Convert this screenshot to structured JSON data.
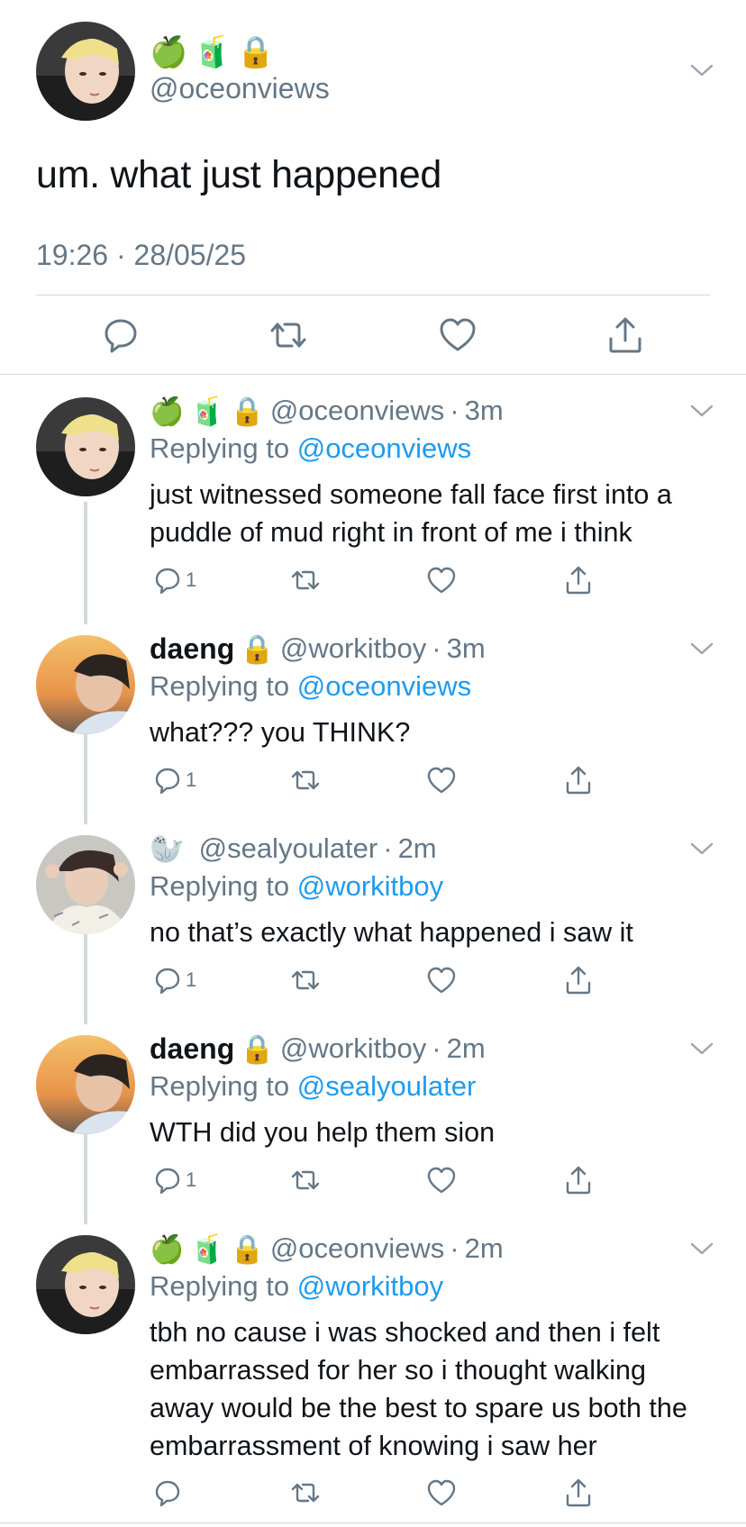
{
  "main": {
    "emojis": [
      "🍏",
      "🧃",
      "🔒"
    ],
    "handle": "@oceonviews",
    "text": "um. what just happened",
    "timestamp": "19:26 · 28/05/25"
  },
  "replies": [
    {
      "name": "",
      "emojis": [
        "🍏",
        "🧃",
        "🔒"
      ],
      "handle": "@oceonviews",
      "time": "3m",
      "replying_prefix": "Replying to",
      "replying_to": "@oceonviews",
      "body": "just witnessed someone fall face first into a puddle of mud right in front of me i think",
      "reply_count": "1"
    },
    {
      "name": "daeng",
      "emojis": [
        "🔒"
      ],
      "handle": "@workitboy",
      "time": "3m",
      "replying_prefix": "Replying to",
      "replying_to": "@oceonviews",
      "body": "what??? you THINK?",
      "reply_count": "1"
    },
    {
      "name": "",
      "emojis": [
        "🦭"
      ],
      "handle": "@sealyoulater",
      "time": "2m",
      "replying_prefix": "Replying to",
      "replying_to": "@workitboy",
      "body": "no that’s exactly what happened i saw it",
      "reply_count": "1"
    },
    {
      "name": "daeng",
      "emojis": [
        "🔒"
      ],
      "handle": "@workitboy",
      "time": "2m",
      "replying_prefix": "Replying to",
      "replying_to": "@sealyoulater",
      "body": "WTH did you help them sion",
      "reply_count": "1"
    },
    {
      "name": "",
      "emojis": [
        "🍏",
        "🧃",
        "🔒"
      ],
      "handle": "@oceonviews",
      "time": "2m",
      "replying_prefix": "Replying to",
      "replying_to": "@workitboy",
      "body": "tbh no cause i was shocked and then i felt embarrassed for her so i thought walking away would be the best to spare us both the embarrassment of knowing i saw her",
      "reply_count": ""
    }
  ],
  "icons": {
    "reply": "reply-icon",
    "retweet": "retweet-icon",
    "like": "heart-icon",
    "share": "share-icon",
    "more": "chevron-down-icon"
  },
  "colors": {
    "link": "#1d9bf0",
    "muted": "#657786",
    "divider": "#cfd9de"
  }
}
